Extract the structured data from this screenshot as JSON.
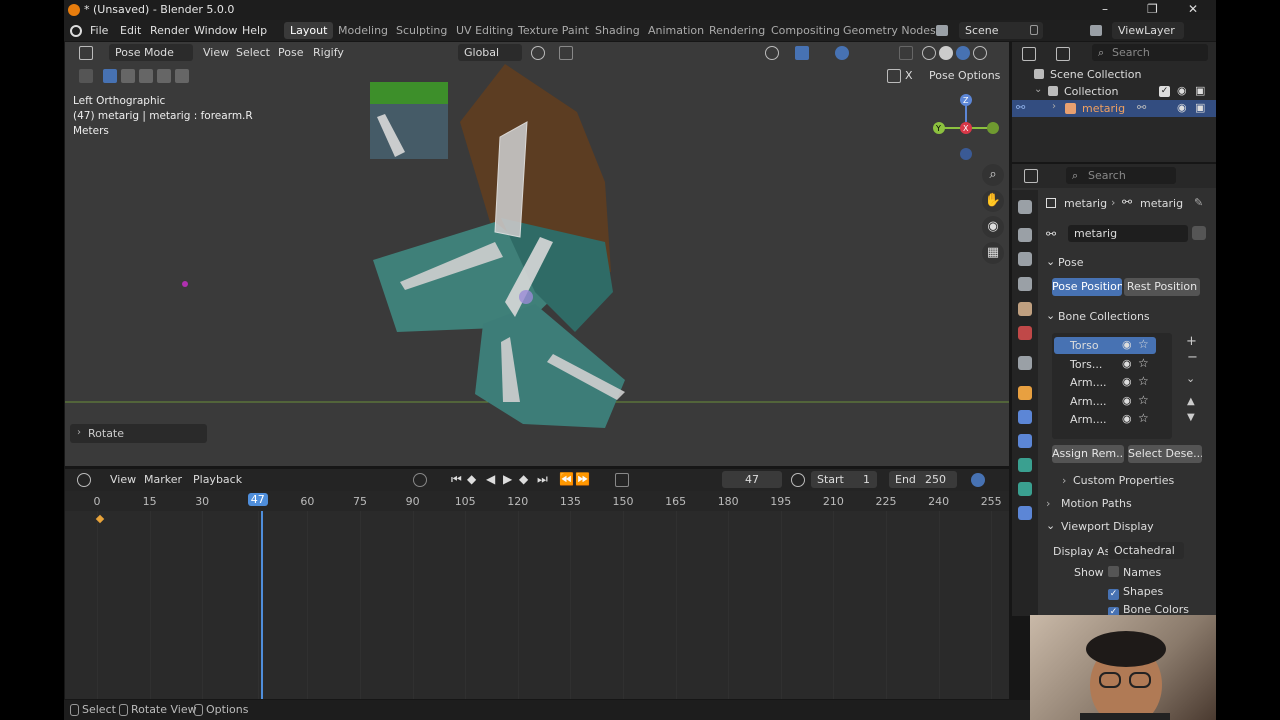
{
  "title_bar": {
    "title": "* (Unsaved) - Blender 5.0.0",
    "minimize": "–",
    "maximize": "❐",
    "close": "✕"
  },
  "menu": {
    "file": "File",
    "edit": "Edit",
    "render": "Render",
    "window": "Window",
    "help": "Help"
  },
  "workspaces": [
    "Layout",
    "Modeling",
    "Sculpting",
    "UV Editing",
    "Texture Paint",
    "Shading",
    "Animation",
    "Rendering",
    "Compositing",
    "Geometry Nodes"
  ],
  "scene": {
    "label": "Scene",
    "view_layer": "ViewLayer"
  },
  "viewport_header": {
    "mode": "Pose Mode",
    "view": "View",
    "select": "Select",
    "pose": "Pose",
    "rigify": "Rigify",
    "orientation": "Global"
  },
  "viewport": {
    "view_name": "Left Orthographic",
    "object_info": "(47) metarig | metarig : forearm.R",
    "units": "Meters",
    "pose_options": "Pose Options",
    "x_label": "X",
    "rotate_panel": "Rotate"
  },
  "gizmo": {
    "z": "Z",
    "y": "Y",
    "x": "X"
  },
  "timeline_header": {
    "view": "View",
    "marker": "Marker",
    "playback": "Playback",
    "current_frame": "47",
    "start_label": "Start",
    "start": "1",
    "end_label": "End",
    "end": "250"
  },
  "timeline_ticks": [
    "0",
    "15",
    "30",
    "47",
    "60",
    "75",
    "90",
    "105",
    "120",
    "135",
    "150",
    "165",
    "180",
    "195",
    "210",
    "225",
    "240",
    "255"
  ],
  "outliner": {
    "search_placeholder": "Search",
    "scene_collection": "Scene Collection",
    "collection": "Collection",
    "object": "metarig"
  },
  "properties": {
    "search_placeholder": "Search",
    "breadcrumb_object": "metarig",
    "breadcrumb_data": "metarig",
    "data_name": "metarig",
    "pose_section": "Pose",
    "pose_position": "Pose Position",
    "rest_position": "Rest Position",
    "bone_collections_section": "Bone Collections",
    "bone_collections": [
      "Torso",
      "Tors...",
      "Arm....",
      "Arm....",
      "Arm...."
    ],
    "assign": "Assign",
    "remove": "Rem...",
    "select": "Select",
    "deselect": "Dese...",
    "custom_properties": "Custom Properties",
    "motion_paths": "Motion Paths",
    "viewport_display": "Viewport Display",
    "display_as_label": "Display As",
    "display_as": "Octahedral",
    "show_label": "Show",
    "names": "Names",
    "shapes": "Shapes",
    "bone_colors": "Bone Colors"
  },
  "status_bar": {
    "select": "Select",
    "rotate_view": "Rotate View",
    "options": "Options"
  },
  "colors": {
    "accent": "#4772b3",
    "playhead": "#4f8edb",
    "keyframe": "#e8a33a",
    "ground_line": "#6a8f3a"
  }
}
